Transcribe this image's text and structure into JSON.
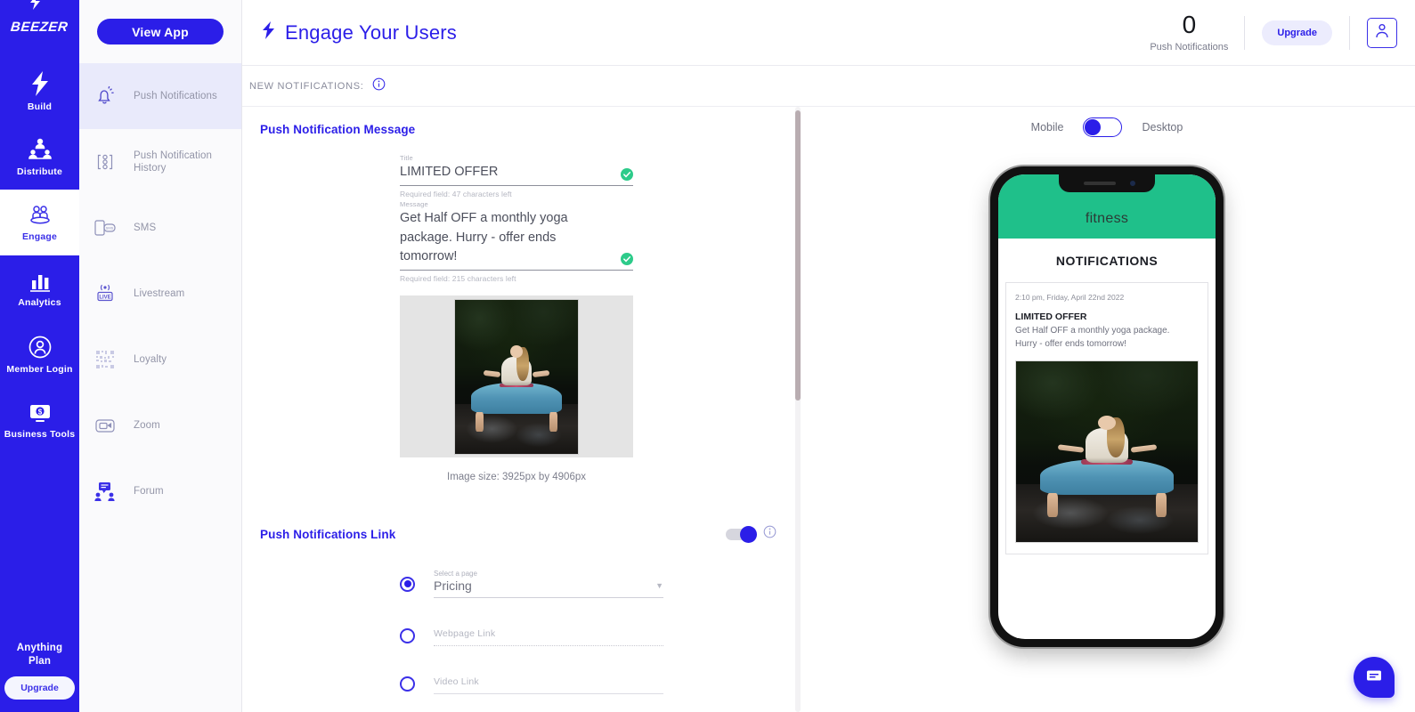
{
  "brand": {
    "name": "BEEZER",
    "bolt_icon": "bolt-icon"
  },
  "rail": {
    "items": [
      {
        "label": "Build",
        "icon": "bolt-icon",
        "active": false
      },
      {
        "label": "Distribute",
        "icon": "distribute-icon",
        "active": false
      },
      {
        "label": "Engage",
        "icon": "engage-people-icon",
        "active": true
      },
      {
        "label": "Analytics",
        "icon": "bar-chart-icon",
        "active": false
      },
      {
        "label": "Member Login",
        "icon": "user-circle-icon",
        "active": false
      },
      {
        "label": "Business Tools",
        "icon": "monitor-dollar-icon",
        "active": false
      }
    ],
    "plan_name": "Anything\nPlan",
    "plan_name_line1": "Anything",
    "plan_name_line2": "Plan",
    "upgrade_label": "Upgrade"
  },
  "subnav": {
    "view_app_label": "View App",
    "items": [
      {
        "label": "Push Notifications",
        "icon": "bell-icon",
        "active": true
      },
      {
        "label": "Push Notification History",
        "icon": "history-flow-icon",
        "active": false
      },
      {
        "label": "SMS",
        "icon": "sms-phone-icon",
        "active": false
      },
      {
        "label": "Livestream",
        "icon": "live-broadcast-icon",
        "active": false
      },
      {
        "label": "Loyalty",
        "icon": "qr-code-icon",
        "active": false
      },
      {
        "label": "Zoom",
        "icon": "video-camera-icon",
        "active": false
      },
      {
        "label": "Forum",
        "icon": "forum-chat-icon",
        "active": false
      }
    ]
  },
  "header": {
    "title": "Engage Your Users",
    "title_icon": "bolt-icon",
    "push_count": "0",
    "push_count_caption": "Push Notifications",
    "upgrade_label": "Upgrade",
    "avatar_icon": "user-avatar-icon"
  },
  "subbar": {
    "label": "NEW NOTIFICATIONS:",
    "info_icon": "info-icon"
  },
  "form": {
    "message_section_title": "Push Notification Message",
    "title_field": {
      "label": "Title",
      "value": "LIMITED OFFER",
      "help": "Required field: 47 characters left",
      "valid_icon": "check-circle-icon"
    },
    "message_field": {
      "label": "Message",
      "value": "Get Half OFF a monthly yoga package. Hurry - offer ends tomorrow!",
      "help": "Required field: 215 characters left",
      "valid_icon": "check-circle-icon"
    },
    "image_caption": "Image size: 3925px by 4906px",
    "image_alt": "yoga-preview-image",
    "link_section_title": "Push Notifications Link",
    "link_toggle_on": true,
    "link_info_icon": "info-icon",
    "options": [
      {
        "kind": "select",
        "selected": true,
        "label": "Select a page",
        "value": "Pricing",
        "caret_icon": "chevron-down-icon"
      },
      {
        "kind": "input",
        "selected": false,
        "placeholder": "Webpage Link",
        "value": ""
      },
      {
        "kind": "input",
        "selected": false,
        "placeholder": "Video Link",
        "value": ""
      }
    ]
  },
  "preview": {
    "mode_left_label": "Mobile",
    "mode_right_label": "Desktop",
    "mode_selected": "Mobile",
    "app_brand": "fitness",
    "screen_title": "NOTIFICATIONS",
    "notification": {
      "timestamp": "2:10 pm, Friday, April 22nd 2022",
      "title": "LIMITED OFFER",
      "body_line1": "Get Half OFF a monthly yoga package.",
      "body_line2": "Hurry - offer ends tomorrow!",
      "image_alt": "yoga-notification-image"
    }
  },
  "chat_fab": {
    "icon": "chat-bubble-icon"
  },
  "colors": {
    "brand_blue": "#2B1EE8",
    "accent_light": "#E9EAFB",
    "success_green": "#2DCB8A",
    "app_header_green": "#1FC08A",
    "muted_text": "#9395A8"
  }
}
